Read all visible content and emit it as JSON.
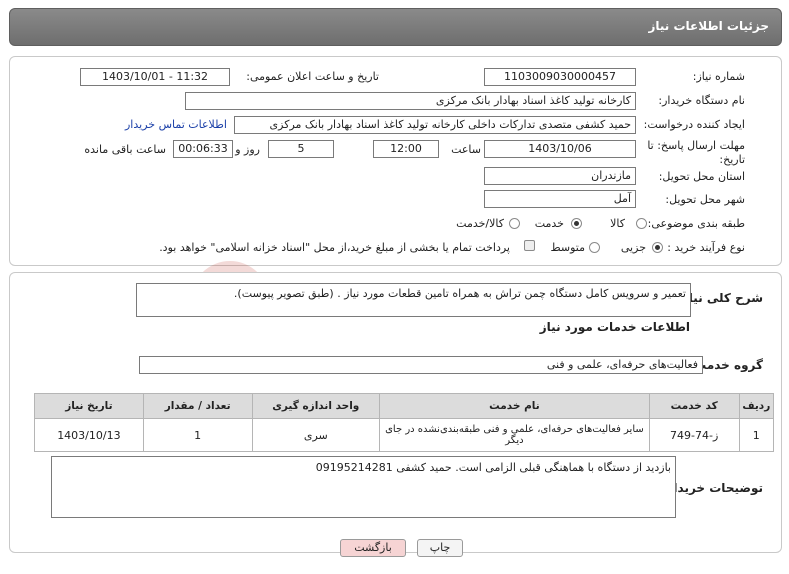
{
  "header": {
    "title": "جزئیات اطلاعات نیاز"
  },
  "form": {
    "need_number_label": "شماره نیاز:",
    "need_number": "1103009030000457",
    "announce_label": "تاریخ و ساعت اعلان عمومی:",
    "announce_value": "1403/10/01 - 11:32",
    "buyer_org_label": "نام دستگاه خریدار:",
    "buyer_org": "کارخانه تولید کاغذ اسناد بهادار بانک مرکزی",
    "requester_label": "ایجاد کننده درخواست:",
    "requester": "حمید کشفی متصدی تدارکات داخلی کارخانه تولید کاغذ اسناد بهادار بانک مرکزی",
    "contact_link": "اطلاعات تماس خریدار",
    "deadline_label": "مهلت ارسال پاسخ: تا تاریخ:",
    "deadline_date": "1403/10/06",
    "time_label": "ساعت",
    "deadline_time": "12:00",
    "days_value": "5",
    "days_label": "روز و",
    "remaining_value": "00:06:33",
    "remaining_label": "ساعت باقی مانده",
    "province_label": "استان محل تحویل:",
    "province": "مازندران",
    "city_label": "شهر محل تحویل:",
    "city": "آمل",
    "category_label": "طبقه بندی موضوعی:",
    "category_options": [
      "کالا",
      "خدمت",
      "کالا/خدمت"
    ],
    "category_selected": "خدمت",
    "process_label": "نوع فرآیند خرید :",
    "process_options": [
      "جزیی",
      "متوسط"
    ],
    "process_selected": "جزیی",
    "payment_note": "پرداخت تمام یا بخشی از مبلغ خرید،از محل \"اسناد خزانه اسلامی\" خواهد بود."
  },
  "description": {
    "label": "شرح کلی نیاز:",
    "text": "تعمیر و سرویس کامل دستگاه چمن تراش به همراه تامین قطعات مورد نیاز . (طبق تصویر پیوست)."
  },
  "services": {
    "section_title": "اطلاعات خدمات مورد نیاز",
    "group_label": "گروه خدمت:",
    "group_value": "فعالیت‌های حرفه‌ای، علمی و فنی",
    "columns": [
      "ردیف",
      "کد خدمت",
      "نام خدمت",
      "واحد اندازه گیری",
      "تعداد / مقدار",
      "تاریخ نیاز"
    ],
    "rows": [
      {
        "row": "1",
        "code": "ز-74-749",
        "name": "سایر فعالیت‌های حرفه‌ای، علمی و فنی طبقه‌بندی‌نشده در جای دیگر",
        "unit": "سری",
        "qty": "1",
        "date": "1403/10/13"
      }
    ]
  },
  "buyer_notes": {
    "label": "توضیحات خریدار:",
    "text": "بازدید از دستگاه با هماهنگی قبلی الزامی است. حمید کشفی 09195214281"
  },
  "buttons": {
    "print": "چاپ",
    "back": "بازگشت"
  },
  "watermark": "AriaTender.neT",
  "colors": {
    "header": "#7a7a7a",
    "back_button": "#f6d4d4",
    "link": "#1a3fa8",
    "watermark": "#c0392b"
  }
}
